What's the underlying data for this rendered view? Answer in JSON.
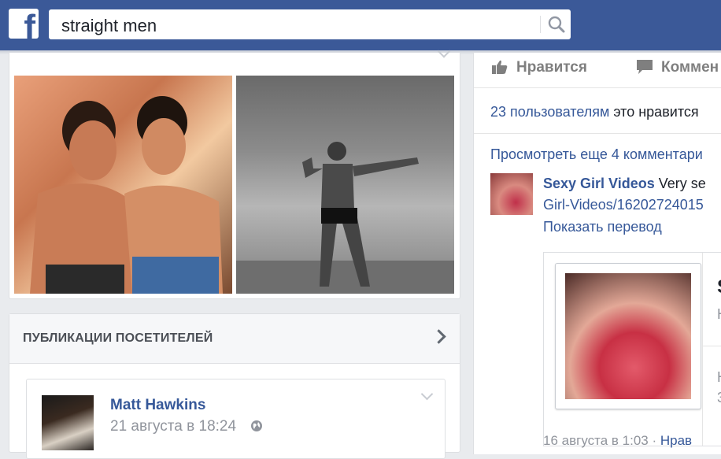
{
  "topbar": {
    "logo": "f",
    "search_value": "straight men",
    "search_icon": "search-icon",
    "color": "#3b5998"
  },
  "photos": {
    "items": [
      {
        "icon": "photo-two-men"
      },
      {
        "icon": "photo-bodybuilder"
      }
    ]
  },
  "visitor_posts": {
    "title": "ПУБЛИКАЦИИ ПОСЕТИТЕЛЕЙ",
    "post": {
      "author": "Matt Hawkins",
      "time": "21 августа в 18:24",
      "privacy_icon": "globe-icon"
    }
  },
  "right": {
    "actions": {
      "like": "Нравится",
      "comment": "Коммен"
    },
    "likes_link": "23 пользователям",
    "likes_rest": " это нравится",
    "more_comments": "Просмотреть еще 4 комментари",
    "comment": {
      "author": "Sexy Girl Videos",
      "text": " Very se",
      "link": "Girl-Videos/16202724015",
      "translate": "Показать перевод"
    },
    "share": {
      "title_fragment": "S",
      "sub1": "Н",
      "sub2": "Н",
      "sub3": "3"
    },
    "meta": {
      "time": "16 августа в 1:03 · ",
      "like": "Нрав"
    }
  }
}
